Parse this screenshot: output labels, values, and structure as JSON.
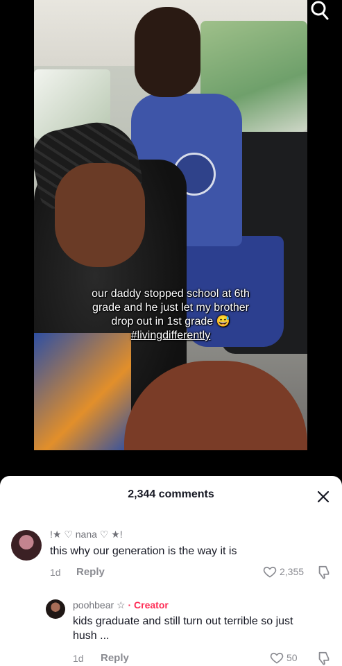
{
  "video": {
    "caption_lines": [
      "our daddy stopped school at 6th",
      "grade and he just let my brother",
      "drop out in 1st grade 😅",
      "#livingdifferently"
    ]
  },
  "comments_panel": {
    "title": "2,344 comments",
    "comments": [
      {
        "username": "!★ ♡ nana ♡ ★!",
        "text": "this why our generation is the way it is",
        "age": "1d",
        "reply_label": "Reply",
        "likes": "2,355"
      },
      {
        "username": "poohbear ☆",
        "creator_label": "· Creator",
        "text_line1": "kids graduate and still turn out terrible so just",
        "text_line2": "hush ...",
        "age": "1d",
        "reply_label": "Reply",
        "likes": "50"
      }
    ]
  },
  "icons": [
    "search-icon",
    "close-icon",
    "heart-icon",
    "dislike-icon"
  ],
  "colors": {
    "creator_accent": "#fe2c55",
    "text_primary": "#161823",
    "text_secondary": "#8a8b91"
  }
}
